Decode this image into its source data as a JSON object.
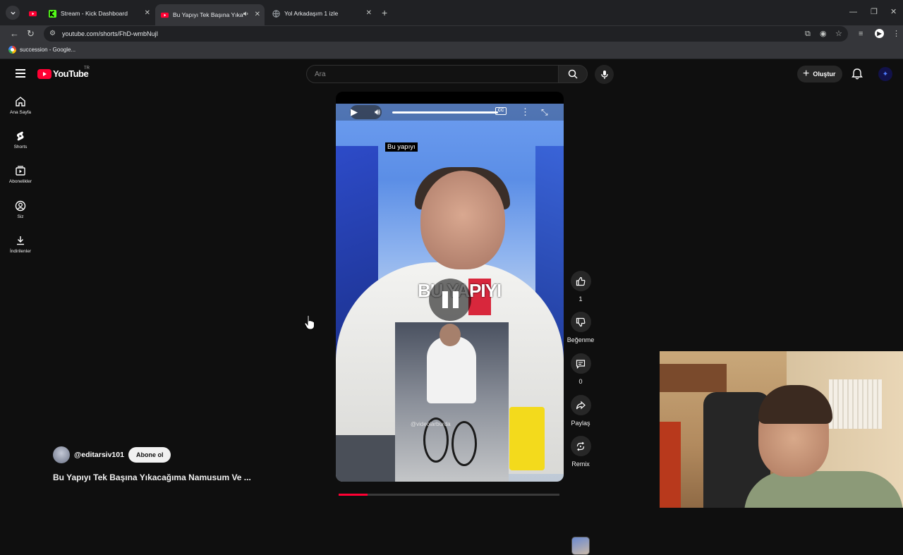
{
  "browser": {
    "tabs": [
      {
        "title": "",
        "favicon": "youtube-icon"
      },
      {
        "title": "Stream - Kick Dashboard",
        "favicon": "kick-icon"
      },
      {
        "title": "Bu Yapıyı Tek Başına Yıkacağ",
        "favicon": "youtube-icon",
        "active": true,
        "audio": true
      },
      {
        "title": "Yol Arkadaşım 1 izle",
        "favicon": "globe-icon"
      }
    ],
    "url": "youtube.com/shorts/FhD-wmbNujI",
    "bookmark": "succession - Google..."
  },
  "youtube": {
    "logo_text": "YouTube",
    "region": "TR",
    "search_placeholder": "Ara",
    "create_label": "Oluştur",
    "sidebar": [
      {
        "label": "Ana Sayfa",
        "icon": "home-icon"
      },
      {
        "label": "Shorts",
        "icon": "shorts-icon"
      },
      {
        "label": "Abonelikler",
        "icon": "subscriptions-icon"
      },
      {
        "label": "Siz",
        "icon": "you-icon"
      },
      {
        "label": "İndirilenler",
        "icon": "download-icon"
      }
    ],
    "short": {
      "caption_top": "Bu yapıyı",
      "caption_overlay": "BU YAPIYI",
      "watermark": "@videolarburda",
      "progress": 0.13,
      "channel": "@editarsiv101",
      "subscribe_label": "Abone ol",
      "title": "Bu Yapıyı Tek Başına Yıkacağıma Namusum Ve ..."
    },
    "actions": {
      "like_count": "1",
      "dislike_label": "Beğenme",
      "comment_count": "0",
      "share_label": "Paylaş",
      "remix_label": "Remix"
    }
  },
  "colors": {
    "accent": "#ff0033",
    "background": "#0f0f0f"
  }
}
